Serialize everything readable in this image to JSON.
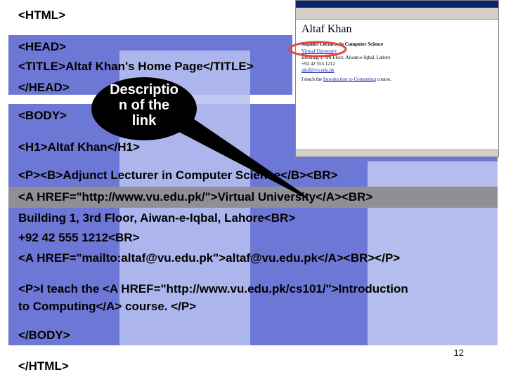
{
  "slide": {
    "lines": {
      "html_open": "<HTML>",
      "head_open": "<HEAD>",
      "title_line": "<TITLE>Altaf Khan's Home Page</TITLE>",
      "head_close": "</HEAD>",
      "body_open": "<BODY>",
      "h1_line": "<H1>Altaf Khan</H1>",
      "p1_line": "<P><B>Adjunct Lecturer in Computer Science</B><BR>",
      "link_line": "<A HREF=\"http://www.vu.edu.pk/\">Virtual University</A><BR>",
      "address_line": "Building 1, 3rd Floor, Aiwan-e-Iqbal, Lahore<BR>",
      "phone_line": "+92 42 555 1212<BR>",
      "mail_line": "<A HREF=\"mailto:altaf@vu.edu.pk\">altaf@vu.edu.pk</A><BR></P>",
      "teach_line1": "<P>I teach the <A HREF=\"http://www.vu.edu.pk/cs101/\">Introduction",
      "teach_line2": "to Computing</A> course. </P>",
      "body_close": "</BODY>",
      "html_close": "</HTML>"
    },
    "callout": {
      "line1": "Descriptio",
      "line2": "n of the",
      "line3": "link"
    },
    "page_number": "12"
  },
  "browser": {
    "heading": "Altaf Khan",
    "bold_line": "Adjunct Lecturer in Computer Science",
    "link_text": "Virtual University",
    "address_partial": "Building 1, 3rd Floor, Aiwan-e-Iqbal, Lahore",
    "phone": "+92 42 555 1212",
    "email": "altaf@vu.edu.pk",
    "teach_prefix": "I teach the ",
    "teach_link": "Introduction to Computing",
    "teach_suffix": " course."
  },
  "colors": {
    "band": "#6d78d6",
    "highlight": "#8f8f95",
    "circle": "#e04848",
    "callout": "#000000"
  }
}
